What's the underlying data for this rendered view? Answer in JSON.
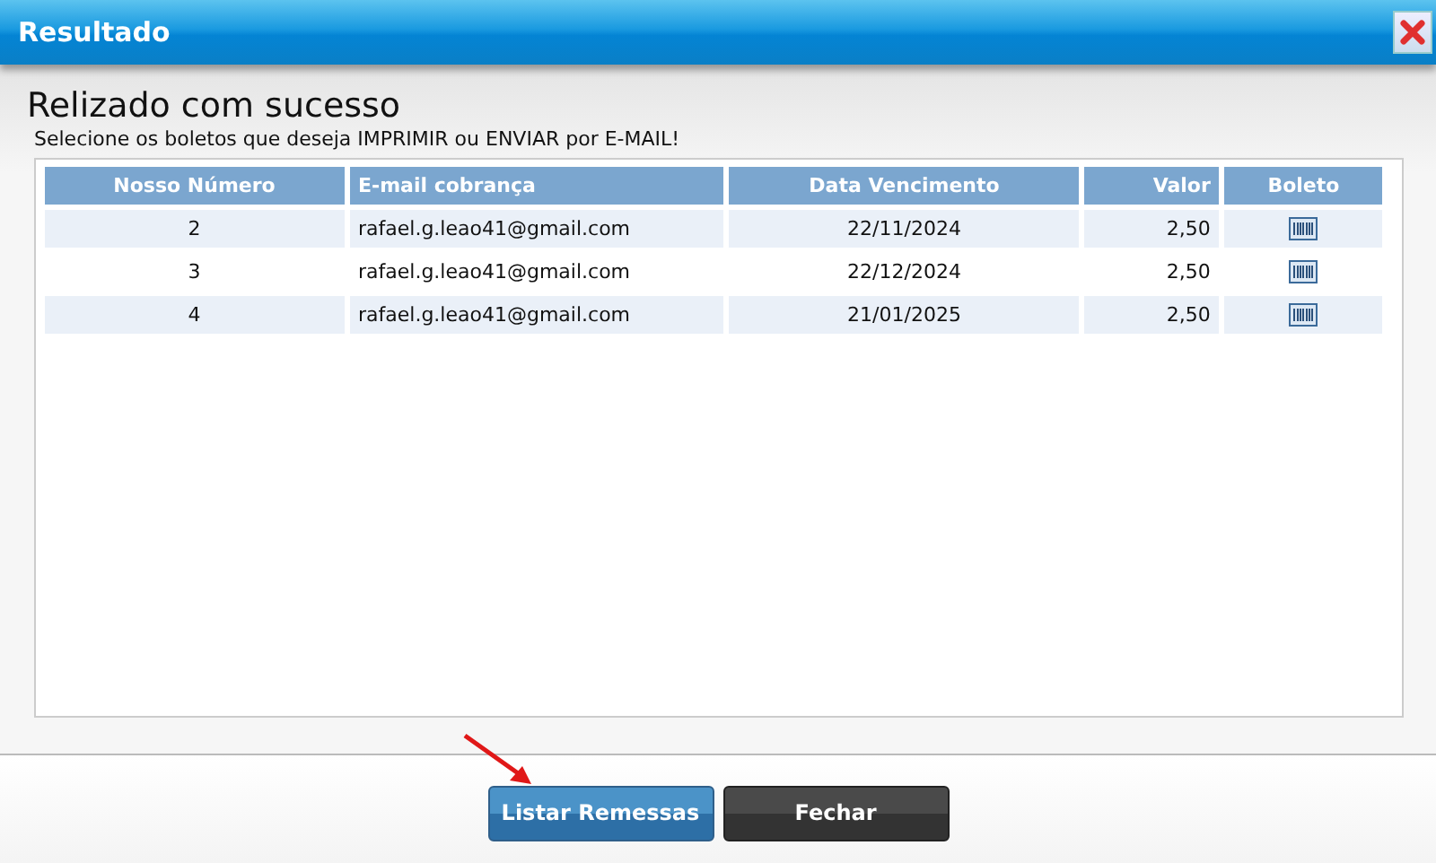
{
  "window": {
    "title": "Resultado"
  },
  "heading": "Relizado com sucesso",
  "instruction": "Selecione os boletos que deseja IMPRIMIR ou ENVIAR por E-MAIL!",
  "table": {
    "columns": [
      "Nosso Número",
      "E-mail cobrança",
      "Data Vencimento",
      "Valor",
      "Boleto"
    ],
    "rows": [
      {
        "nosso_numero": "2",
        "email": "rafael.g.leao41@gmail.com",
        "vencimento": "22/11/2024",
        "valor": "2,50"
      },
      {
        "nosso_numero": "3",
        "email": "rafael.g.leao41@gmail.com",
        "vencimento": "22/12/2024",
        "valor": "2,50"
      },
      {
        "nosso_numero": "4",
        "email": "rafael.g.leao41@gmail.com",
        "vencimento": "21/01/2025",
        "valor": "2,50"
      }
    ]
  },
  "buttons": [
    {
      "label": "Listar Remessas",
      "kind": "primary"
    },
    {
      "label": "Fechar",
      "kind": "dark"
    }
  ]
}
